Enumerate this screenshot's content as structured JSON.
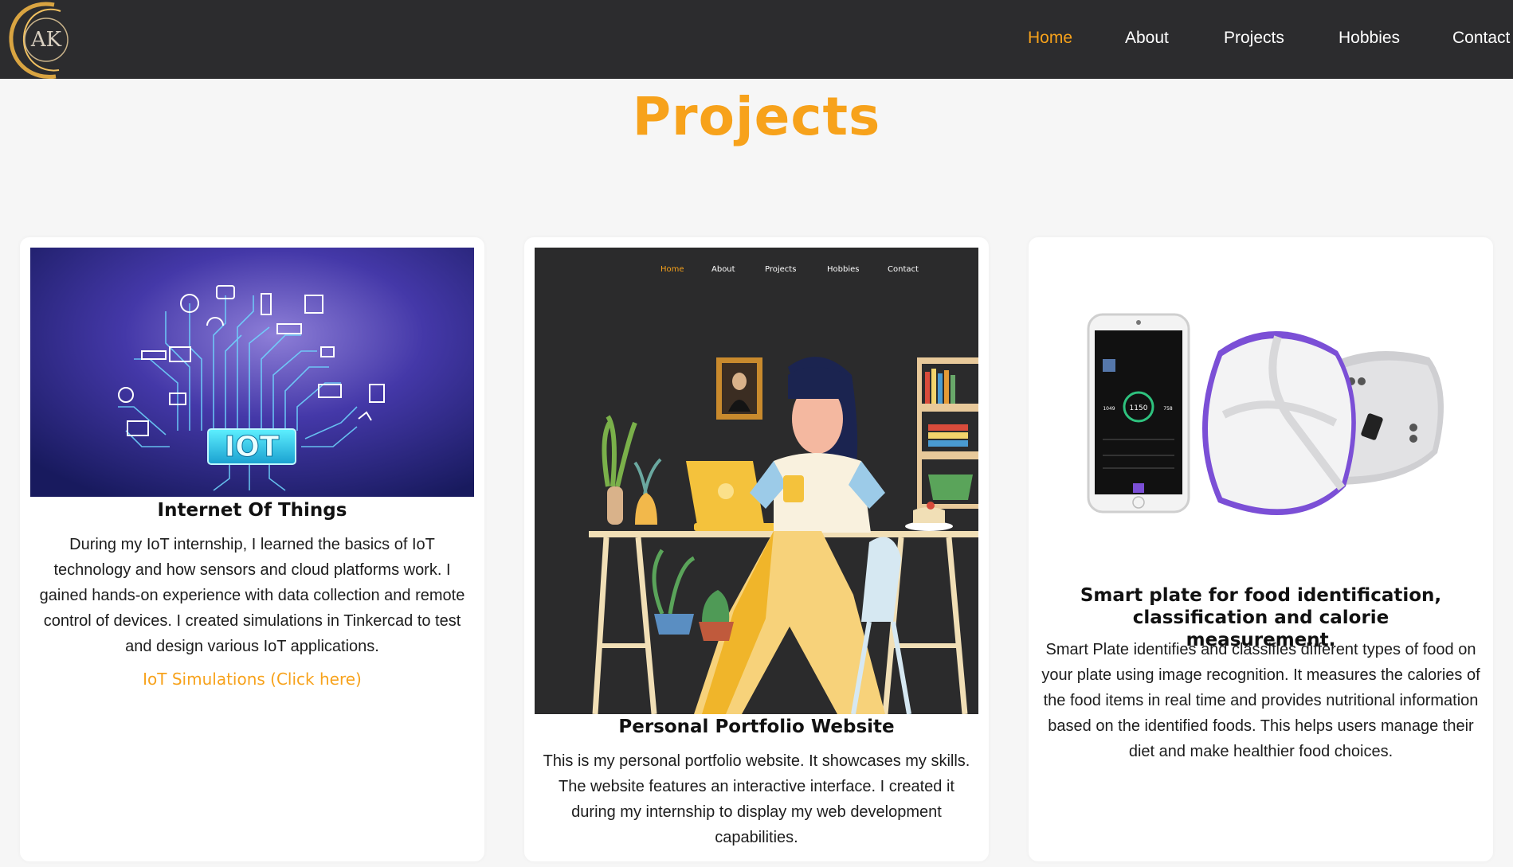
{
  "nav": {
    "logo_text": "AK",
    "links": [
      {
        "label": "Home",
        "active": true
      },
      {
        "label": "About",
        "active": false
      },
      {
        "label": "Projects",
        "active": false
      },
      {
        "label": "Hobbies",
        "active": false
      },
      {
        "label": "Contact",
        "active": false
      }
    ]
  },
  "page": {
    "title": "Projects"
  },
  "colors": {
    "accent": "#f7a21b",
    "nav_bg": "#2c2c2e",
    "card_bg": "#ffffff",
    "page_bg": "#f6f6f6"
  },
  "projects": [
    {
      "title": "Internet Of Things",
      "image_label": "IOT",
      "description": "During my IoT internship, I learned the basics of IoT technology and how sensors and cloud platforms work. I gained hands-on experience with data collection and remote control of devices. I created simulations in Tinkercad to test and design various IoT applications.",
      "link_label": "IoT Simulations (Click here)"
    },
    {
      "title": "Personal Portfolio Website",
      "image_nav": [
        "Home",
        "About",
        "Projects",
        "Hobbies",
        "Contact"
      ],
      "description": "This is my personal portfolio website. It showcases my skills. The website features an interactive interface. I created it during my internship to display my web development capabilities."
    },
    {
      "title": "Smart plate for food identification, classification and calorie measurement.",
      "image_phone": {
        "calories": "1150",
        "eaten": "1049",
        "burned": "758"
      },
      "description": "Smart Plate identifies and classifies different types of food on your plate using image recognition. It measures the calories of the food items in real time and provides nutritional information based on the identified foods. This helps users manage their diet and make healthier food choices."
    }
  ]
}
